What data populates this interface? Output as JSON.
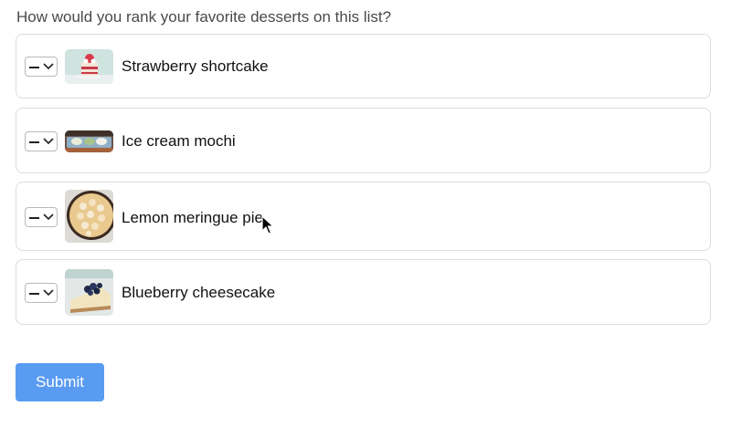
{
  "question": "How would you rank your favorite desserts on this list?",
  "items": [
    {
      "rank": "",
      "label": "Strawberry shortcake",
      "icon": "strawberry-shortcake-image"
    },
    {
      "rank": "",
      "label": "Ice cream mochi",
      "icon": "ice-cream-mochi-image"
    },
    {
      "rank": "",
      "label": "Lemon meringue pie",
      "icon": "lemon-meringue-pie-image"
    },
    {
      "rank": "",
      "label": "Blueberry cheesecake",
      "icon": "blueberry-cheesecake-image"
    }
  ],
  "submit_label": "Submit",
  "colors": {
    "submit_bg": "#5a9bf2",
    "card_border": "#dcdcdc"
  }
}
